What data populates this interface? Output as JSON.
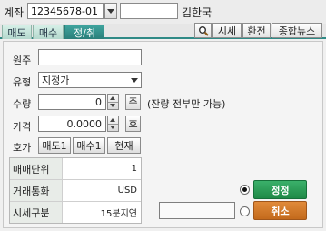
{
  "account": {
    "label": "계좌",
    "number": "12345678-01",
    "password_value": "",
    "holder_name": "김한국"
  },
  "tabs": [
    {
      "label": "매도",
      "active": false
    },
    {
      "label": "매수",
      "active": false
    },
    {
      "label": "정/취",
      "active": true
    }
  ],
  "toolbar": {
    "search_icon": "magnifier-icon",
    "quote_label": "시세",
    "exchange_label": "환전",
    "news_label": "종합뉴스"
  },
  "form": {
    "original_order_label": "원주",
    "original_order_value": "",
    "type_label": "유형",
    "type_value": "지정가",
    "quantity_label": "수량",
    "quantity_value": "0",
    "quantity_unit": "주",
    "quantity_note": "(잔량 전부만 가능)",
    "price_label": "가격",
    "price_value": "0.0000",
    "price_unit": "호",
    "quote_label": "호가",
    "sell1_label": "매도1",
    "buy1_label": "매수1",
    "current_label": "현재"
  },
  "info": [
    {
      "key": "매매단위",
      "value": "1"
    },
    {
      "key": "거래통화",
      "value": "USD"
    },
    {
      "key": "시세구분",
      "value": "15분지연"
    }
  ],
  "actions": {
    "modify_label": "정정",
    "modify_selected": true,
    "cancel_label": "취소",
    "cancel_selected": false,
    "cancel_field_value": ""
  },
  "colors": {
    "tab_active": "#2a7f7a",
    "modify_button": "#1f8a47",
    "cancel_button": "#c36a1c"
  }
}
